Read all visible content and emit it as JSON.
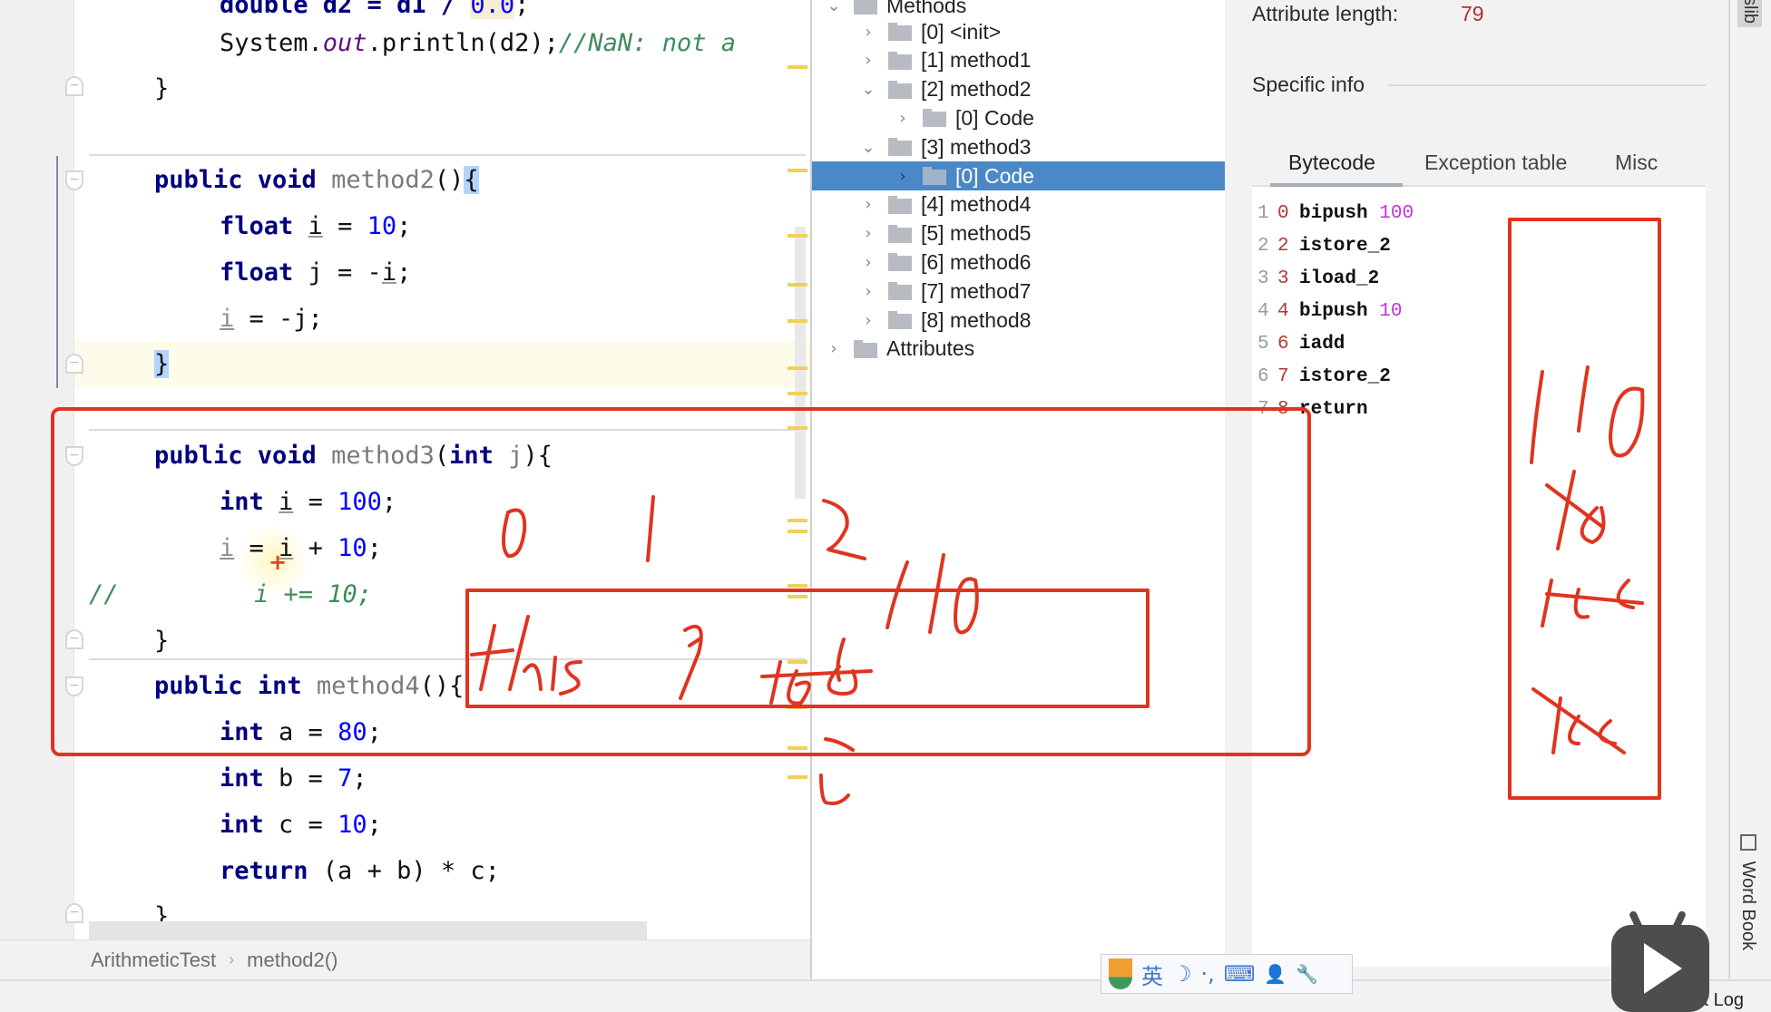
{
  "editor": {
    "lines": {
      "l0_a": "double d2 = d1 / ",
      "l0_b": "0.0",
      "l0_c": ";",
      "l1_a": "System.",
      "l1_field": "out",
      "l1_b": ".println(d2);",
      "l1_cmt": "//NaN: not a ",
      "l2": "}",
      "m2_kw": "public void",
      "m2_name": "method2",
      "m2_paren": "()",
      "m2_brace": "{",
      "m2_l1_kw": "float",
      "m2_l1_var": "i",
      "m2_l1_eq": " = ",
      "m2_l1_num": "10",
      "m2_l1_end": ";",
      "m2_l2_kw": "float",
      "m2_l2_rest_a": " j = -",
      "m2_l2_var": "i",
      "m2_l2_end": ";",
      "m2_l3_var": "i",
      "m2_l3_rest": " = -j;",
      "m2_close": "}",
      "m3_kw": "public void",
      "m3_name": "method3",
      "m3_open": "(",
      "m3_ptype": "int",
      "m3_pname": "j",
      "m3_close": "){",
      "m3_l1_kw": "int",
      "m3_l1_var": "i",
      "m3_l1_eq": " = ",
      "m3_l1_num": "100",
      "m3_l1_end": ";",
      "m3_l2_var1": "i",
      "m3_l2_eq": " = ",
      "m3_l2_var2": "i",
      "m3_l2_plus": " + ",
      "m3_l2_num": "10",
      "m3_l2_end": ";",
      "m3_comment_slashes": "//",
      "m3_l3_cmt": "i += 10;",
      "m3_end": "}",
      "m4_kw1": "public",
      "m4_kw2": "int",
      "m4_name": "method4",
      "m4_paren": "(){",
      "m4_l1_kw": "int",
      "m4_l1_rest": " a = ",
      "m4_l1_num": "80",
      "m4_l1_end": ";",
      "m4_l2_kw": "int",
      "m4_l2_rest": " b = ",
      "m4_l2_num": "7",
      "m4_l2_end": ";",
      "m4_l3_kw": "int",
      "m4_l3_rest": " c = ",
      "m4_l3_num": "10",
      "m4_l3_end": ";",
      "m4_l4_kw": "return",
      "m4_l4_rest": " (a + b) * c;",
      "m4_end": "}"
    },
    "breadcrumb": [
      "ArithmeticTest",
      "method2()"
    ],
    "breadcrumb_sep": "›"
  },
  "tree": {
    "root_label": "Methods",
    "items": [
      {
        "label": "[0] <init>",
        "expanded": false,
        "level": 1
      },
      {
        "label": "[1] method1",
        "expanded": false,
        "level": 1
      },
      {
        "label": "[2] method2",
        "expanded": true,
        "level": 1
      },
      {
        "label": "[0] Code",
        "expanded": false,
        "level": 2
      },
      {
        "label": "[3] method3",
        "expanded": true,
        "level": 1
      },
      {
        "label": "[0] Code",
        "expanded": false,
        "level": 2,
        "selected": true
      },
      {
        "label": "[4] method4",
        "expanded": false,
        "level": 1
      },
      {
        "label": "[5] method5",
        "expanded": false,
        "level": 1
      },
      {
        "label": "[6] method6",
        "expanded": false,
        "level": 1
      },
      {
        "label": "[7] method7",
        "expanded": false,
        "level": 1
      },
      {
        "label": "[8] method8",
        "expanded": false,
        "level": 1
      },
      {
        "label": "Attributes",
        "expanded": false,
        "level": 0
      }
    ],
    "chevron_collapsed": "›",
    "chevron_expanded": "⌄"
  },
  "info": {
    "attribute_length_label": "Attribute length:",
    "attribute_length_value": "79",
    "specific_info_label": "Specific info",
    "tabs": [
      "Bytecode",
      "Exception table",
      "Misc"
    ],
    "active_tab": "Bytecode",
    "bytecode": [
      {
        "line": "1",
        "offset": "0",
        "op": "bipush",
        "arg": "100"
      },
      {
        "line": "2",
        "offset": "2",
        "op": "istore_2",
        "arg": ""
      },
      {
        "line": "3",
        "offset": "3",
        "op": "iload_2",
        "arg": ""
      },
      {
        "line": "4",
        "offset": "4",
        "op": "bipush",
        "arg": "10"
      },
      {
        "line": "5",
        "offset": "6",
        "op": "iadd",
        "arg": ""
      },
      {
        "line": "6",
        "offset": "7",
        "op": "istore_2",
        "arg": ""
      },
      {
        "line": "7",
        "offset": "8",
        "op": "return",
        "arg": ""
      }
    ]
  },
  "side_strip": {
    "top_tab": "jclasslib",
    "bottom_tab": "Word Book"
  },
  "status": {
    "event_log": "Event Log"
  },
  "ime_toolbar": {
    "lang": "英",
    "items": [
      "moon-icon",
      "punctuation-icon",
      "keyboard-icon",
      "user-icon",
      "wrench-icon"
    ],
    "punct": "·,",
    "keyboard": "⌨",
    "user": "👤",
    "wrench": "🔧",
    "moon": "☽"
  },
  "annotations": {
    "color": "#e0341f",
    "local_var_indices": [
      "0",
      "1",
      "2"
    ],
    "local_var_slots": [
      "this",
      "j",
      "110"
    ],
    "local_var_slot_struck": "100",
    "operand_stack": [
      "110",
      "10",
      "120",
      "100"
    ],
    "var_under_slot": "i"
  }
}
